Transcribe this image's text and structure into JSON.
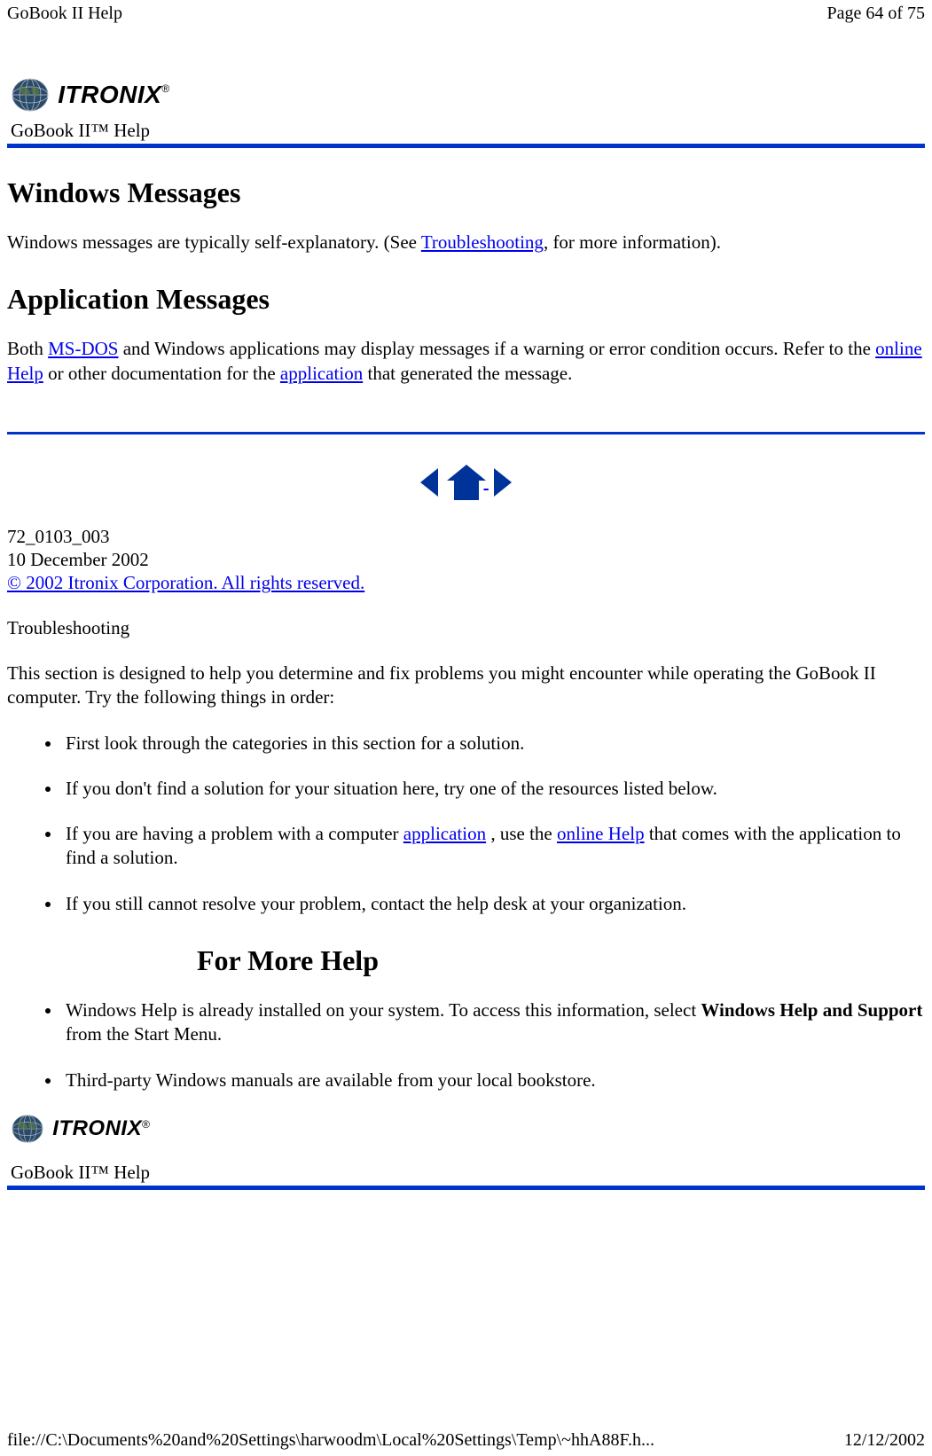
{
  "header": {
    "left": "GoBook II Help",
    "right": "Page 64 of 75"
  },
  "logo": {
    "brand": "ITRONIX",
    "reg": "®"
  },
  "subtitle": "GoBook II™ Help",
  "headings": {
    "h1": "Windows Messages",
    "h2": "Application Messages",
    "h3": "For More Help"
  },
  "para1": {
    "pre": "Windows messages are typically self-explanatory. (See ",
    "link": "Troubleshooting",
    "post": ", for more information)."
  },
  "para2": {
    "t1": "Both ",
    "link1": "MS-DOS",
    "t2": " and Windows applications may display messages if a warning or error condition occurs. Refer to the ",
    "link2": "online Help",
    "t3": " or other documentation for the ",
    "link3": "application",
    "t4": " that generated the message."
  },
  "docinfo": {
    "line1": "72_0103_003",
    "line2": "10 December 2002",
    "copyright": "© 2002 Itronix Corporation.  All rights reserved."
  },
  "troubleshooting": {
    "title": "Troubleshooting",
    "intro": "This section is designed to help you determine and fix problems you might encounter while operating the GoBook II computer. Try the following things in order:"
  },
  "bullets1": {
    "b1": "First look through the categories in this section for a solution.",
    "b2": "If you don't find a solution for your situation here, try one of the resources listed below.",
    "b3": {
      "t1": "If you are having a problem with a computer ",
      "link1": "application",
      "t2": " , use the ",
      "link2": "online Help",
      "t3": " that comes with the application to find a solution."
    },
    "b4": "If you still cannot resolve your problem, contact the help desk at your organization."
  },
  "bullets2": {
    "b1": {
      "t1": "Windows Help is already installed on your system.  To access this information, select ",
      "bold": "Windows Help and Support",
      "t2": " from the Start Menu."
    },
    "b2": "Third-party Windows manuals are available from your local bookstore."
  },
  "footer": {
    "left": "file://C:\\Documents%20and%20Settings\\harwoodm\\Local%20Settings\\Temp\\~hhA88F.h...",
    "right": "12/12/2002"
  }
}
